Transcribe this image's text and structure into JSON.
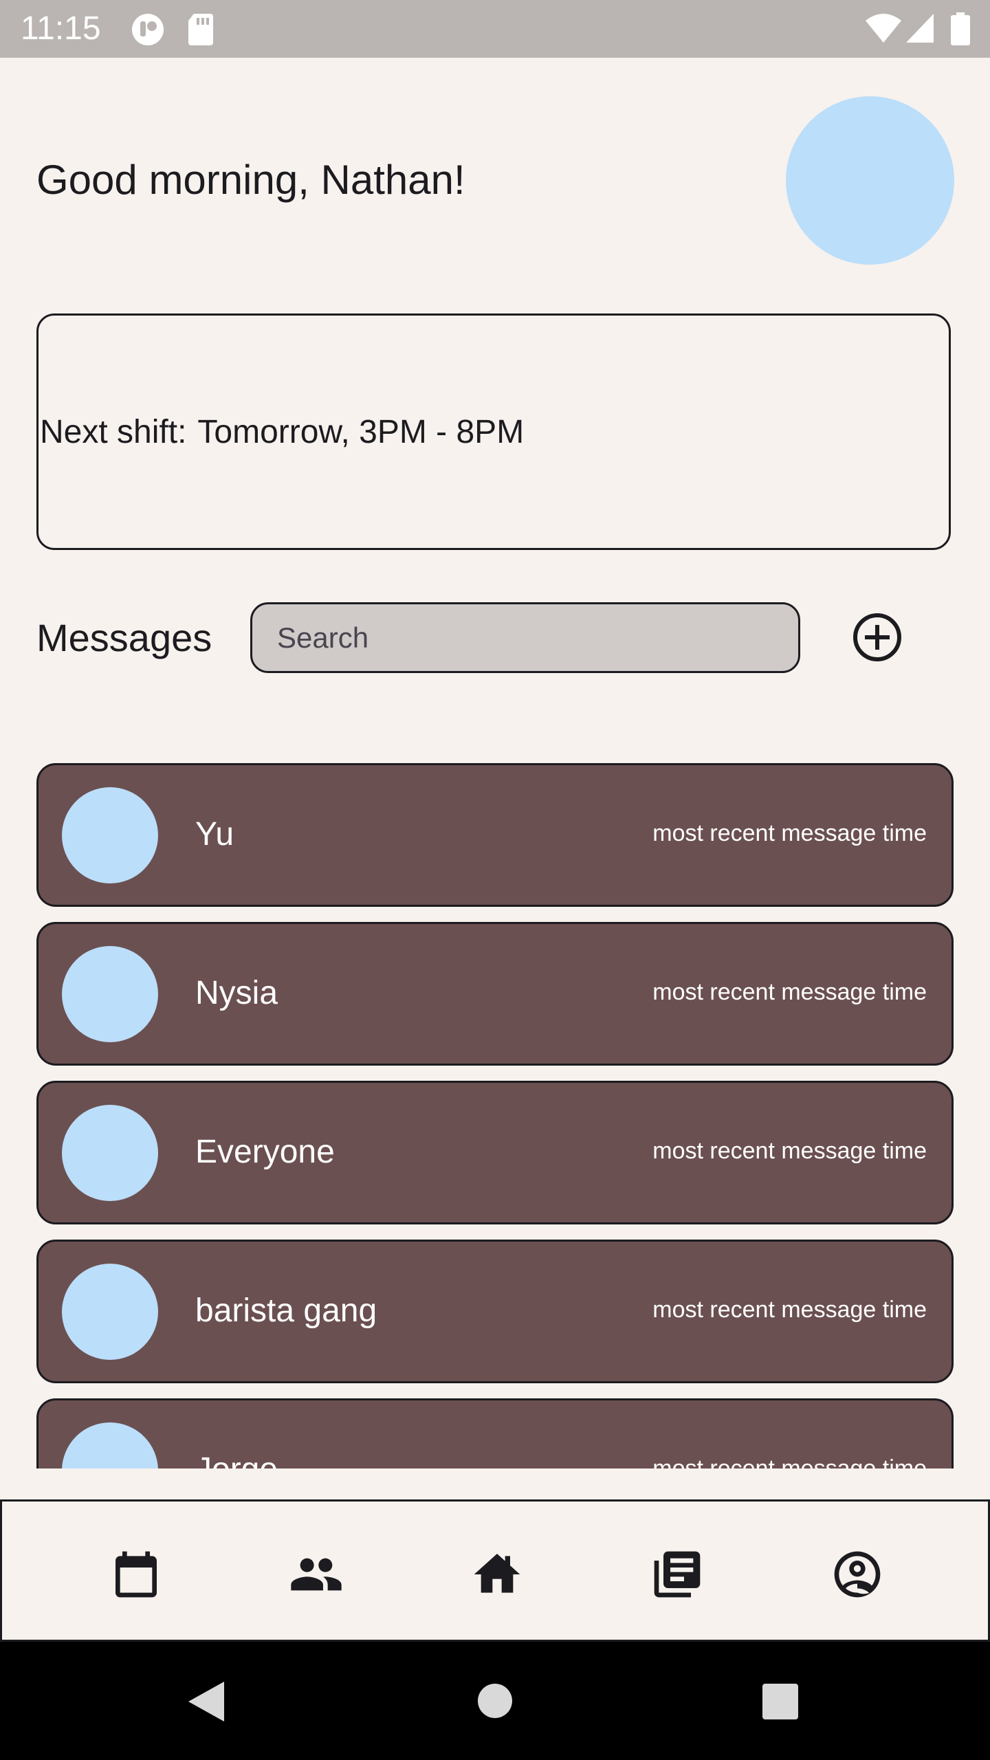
{
  "status_bar": {
    "time": "11:15"
  },
  "header": {
    "greeting": "Good morning, Nathan!"
  },
  "shift_card": {
    "label": "Next shift:",
    "value": "Tomorrow, 3PM - 8PM"
  },
  "messages": {
    "title": "Messages",
    "search_placeholder": "Search",
    "conversations": [
      {
        "name": "Yu",
        "time": "most recent message time"
      },
      {
        "name": "Nysia",
        "time": "most recent message time"
      },
      {
        "name": "Everyone",
        "time": "most recent message time"
      },
      {
        "name": "barista gang",
        "time": "most recent message time"
      },
      {
        "name": "Jorge",
        "time": "most recent message time"
      }
    ]
  },
  "bottom_nav": {
    "items": [
      {
        "icon": "calendar-icon"
      },
      {
        "icon": "people-icon"
      },
      {
        "icon": "home-icon"
      },
      {
        "icon": "news-icon"
      },
      {
        "icon": "account-circle-icon"
      }
    ]
  },
  "colors": {
    "background": "#f7f2ee",
    "card": "#6b5051",
    "avatar": "#bbdefa",
    "search_fill": "#d0cbc9",
    "status_bar": "#bab5b2"
  }
}
